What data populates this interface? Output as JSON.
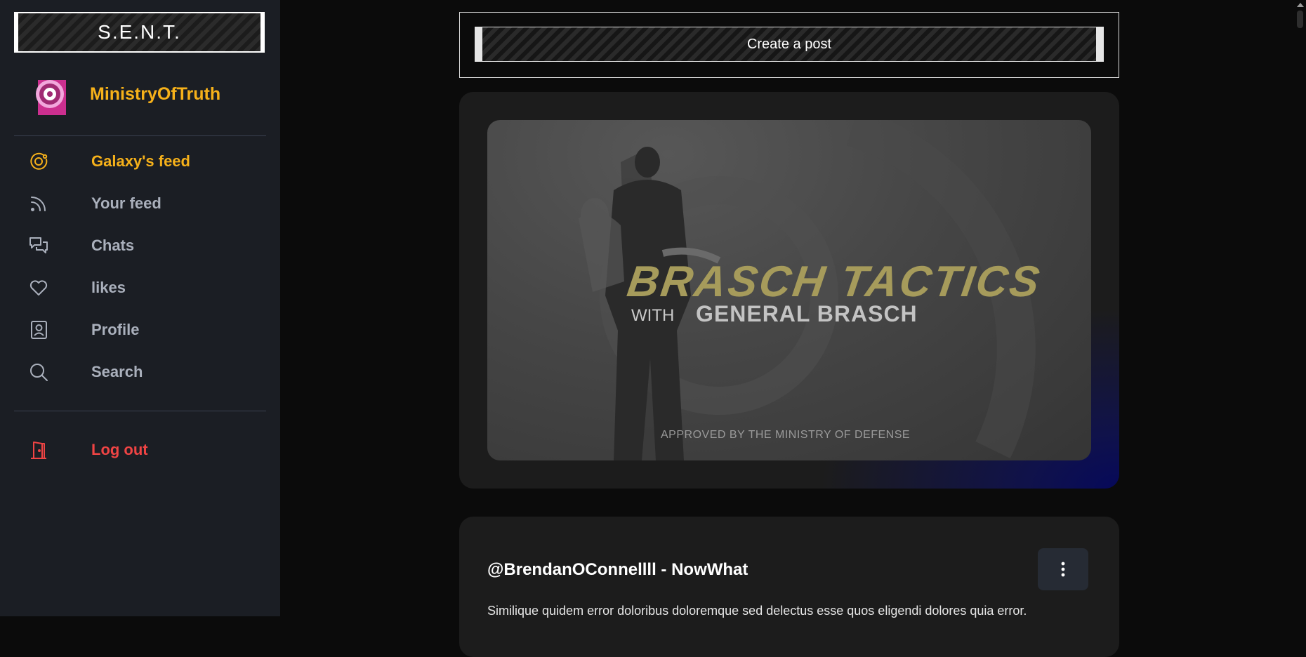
{
  "brand": {
    "title": "S.E.N.T."
  },
  "user": {
    "name": "MinistryOfTruth",
    "avatar_icon": "radio-target-avatar"
  },
  "nav": {
    "items": [
      {
        "label": "Galaxy's feed",
        "icon": "orbit-icon",
        "active": true
      },
      {
        "label": "Your feed",
        "icon": "rss-icon"
      },
      {
        "label": "Chats",
        "icon": "chat-bubbles-icon"
      },
      {
        "label": "likes",
        "icon": "heart-icon"
      },
      {
        "label": "Profile",
        "icon": "profile-card-icon"
      },
      {
        "label": "Search",
        "icon": "search-icon"
      }
    ],
    "logout": {
      "label": "Log out",
      "icon": "door-exit-icon"
    }
  },
  "feed": {
    "create_post_label": "Create a post",
    "posts": [
      {
        "banner": {
          "title": "BRASCH TACTICS",
          "with": "WITH",
          "subtitle": "GENERAL BRASCH",
          "footer": "APPROVED BY THE MINISTRY OF DEFENSE"
        }
      },
      {
        "author": "@BrendanOConnellll  - NowWhat",
        "text": "Similique quidem error doloribus doloremque sed delectus esse quos eligendi dolores quia error.",
        "menu_icon": "kebab-menu-icon"
      }
    ]
  },
  "colors": {
    "accent": "#f6b11a",
    "danger": "#ef4444",
    "sidebar_bg": "#1b1e24",
    "page_bg": "#0b0b0b"
  }
}
